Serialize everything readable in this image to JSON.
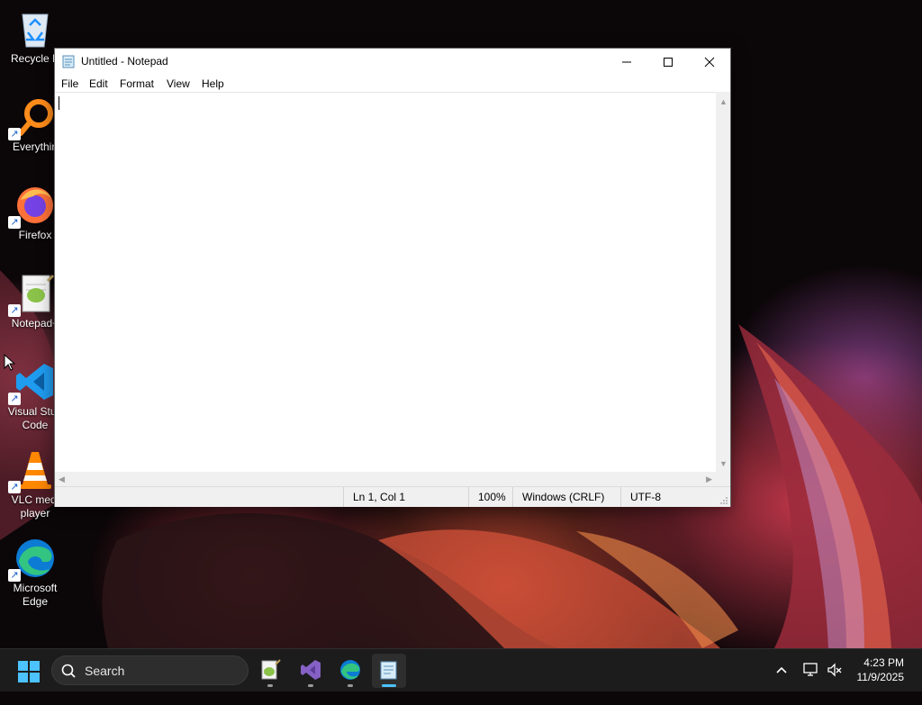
{
  "desktop": {
    "icons": [
      {
        "label": "Recycle B",
        "icon": "recycle-bin-icon"
      },
      {
        "label": "Everythin",
        "icon": "everything-search-icon"
      },
      {
        "label": "Firefox",
        "icon": "firefox-icon"
      },
      {
        "label": "Notepad+",
        "icon": "notepad-plus-plus-icon"
      },
      {
        "label": "Visual Stud\nCode",
        "icon": "vscode-icon"
      },
      {
        "label": "VLC medi\nplayer",
        "icon": "vlc-icon"
      },
      {
        "label": "Microsoft\nEdge",
        "icon": "edge-icon"
      }
    ]
  },
  "window": {
    "title": "Untitled - Notepad",
    "app_icon": "notepad-icon",
    "controls": {
      "minimize": "minimize-icon",
      "maximize": "maximize-icon",
      "close": "close-icon"
    },
    "menu": [
      "File",
      "Edit",
      "Format",
      "View",
      "Help"
    ],
    "content": "",
    "status": {
      "position": "Ln 1, Col 1",
      "zoom": "100%",
      "line_ending": "Windows (CRLF)",
      "encoding": "UTF-8"
    }
  },
  "taskbar": {
    "start_icon": "windows-start-icon",
    "search_placeholder": "Search",
    "apps": [
      {
        "name": "notepad-plus-plus-icon",
        "active": false
      },
      {
        "name": "visual-studio-icon",
        "active": false
      },
      {
        "name": "edge-icon",
        "active": false
      },
      {
        "name": "notepad-icon",
        "active": true
      }
    ],
    "tray": {
      "overflow_icon": "chevron-up-icon",
      "network_icon": "network-icon",
      "volume_icon": "volume-muted-icon"
    },
    "clock": {
      "time": "4:23 PM",
      "date": "11/9/2025"
    }
  },
  "colors": {
    "taskbar_bg": "#1c1c1c",
    "active_indicator": "#4cc2ff",
    "window_bg": "#ffffff",
    "statusbar_bg": "#f0f0f0"
  }
}
